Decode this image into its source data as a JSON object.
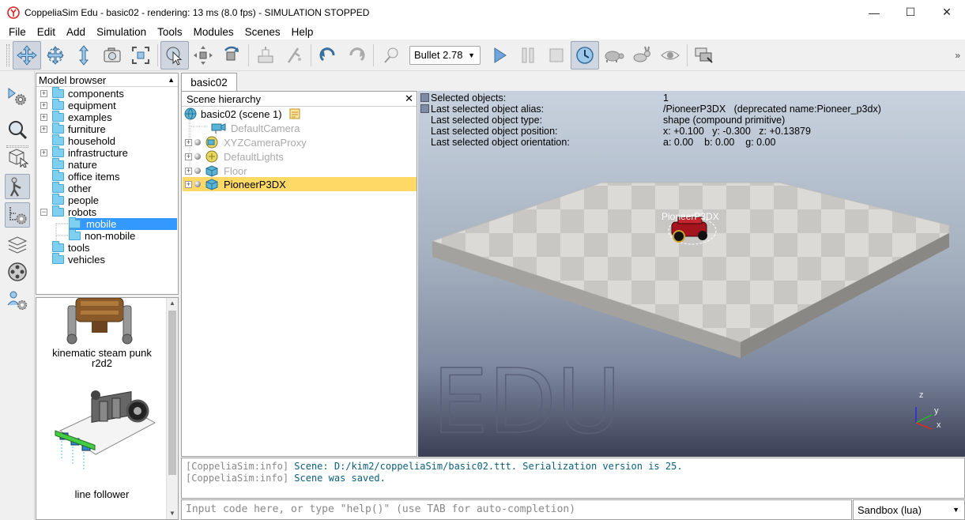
{
  "window": {
    "title": "CoppeliaSim Edu - basic02 - rendering: 13 ms (8.0 fps) - SIMULATION STOPPED",
    "minimize": "—",
    "maximize": "☐",
    "close": "✕"
  },
  "menu": [
    "File",
    "Edit",
    "Add",
    "Simulation",
    "Tools",
    "Modules",
    "Scenes",
    "Help"
  ],
  "toolbar": {
    "engine_select": "Bullet 2.78",
    "more": "»"
  },
  "model_browser": {
    "title": "Model browser",
    "items": [
      {
        "label": "components",
        "expandable": true
      },
      {
        "label": "equipment",
        "expandable": true
      },
      {
        "label": "examples",
        "expandable": true
      },
      {
        "label": "furniture",
        "expandable": true
      },
      {
        "label": "household",
        "expandable": false
      },
      {
        "label": "infrastructure",
        "expandable": true
      },
      {
        "label": "nature",
        "expandable": false
      },
      {
        "label": "office items",
        "expandable": false
      },
      {
        "label": "other",
        "expandable": false
      },
      {
        "label": "people",
        "expandable": false
      },
      {
        "label": "robots",
        "expandable": true,
        "expanded": true
      },
      {
        "label": "mobile",
        "expandable": false,
        "child": true,
        "selected": true
      },
      {
        "label": "non-mobile",
        "expandable": false,
        "child": true
      },
      {
        "label": "tools",
        "expandable": false
      },
      {
        "label": "vehicles",
        "expandable": false
      }
    ]
  },
  "thumbnails": [
    {
      "label_line1": "kinematic steam punk",
      "label_line2": "r2d2"
    },
    {
      "label_line1": "line follower",
      "label_line2": ""
    }
  ],
  "scene_tab": "basic02",
  "hierarchy": {
    "title": "Scene hierarchy",
    "close": "✕",
    "root": "basic02 (scene 1)",
    "items": [
      {
        "label": "DefaultCamera",
        "dim": true,
        "expandable": false
      },
      {
        "label": "XYZCameraProxy",
        "dim": true,
        "expandable": true
      },
      {
        "label": "DefaultLights",
        "dim": true,
        "expandable": true
      },
      {
        "label": "Floor",
        "dim": true,
        "expandable": true
      },
      {
        "label": "PioneerP3DX",
        "dim": false,
        "expandable": true,
        "selected": true
      }
    ]
  },
  "selection_info": {
    "rows": [
      {
        "key": "Selected objects:",
        "value": "1"
      },
      {
        "key": "Last selected object alias:",
        "value": "/PioneerP3DX   (deprecated name:Pioneer_p3dx)"
      },
      {
        "key": "Last selected object type:",
        "value": "shape (compound primitive)"
      },
      {
        "key": "Last selected object position:",
        "value": "x: +0.100   y: -0.300   z: +0.13879"
      },
      {
        "key": "Last selected object orientation:",
        "value": "a: 0.00    b: 0.00    g: 0.00"
      }
    ]
  },
  "viewport": {
    "robot_label": "PioneerP3DX",
    "watermark": "EDU",
    "axis_z": "z",
    "axis_y": "y",
    "axis_x": "x"
  },
  "console": {
    "lines": [
      {
        "tag": "[CoppeliaSim:info]",
        "msg": "Scene: D:/kim2/coppeliaSim/basic02.ttt. Serialization version is 25."
      },
      {
        "tag": "[CoppeliaSim:info]",
        "msg": "Scene was saved."
      }
    ],
    "input_placeholder": "Input code here, or type \"help()\" (use TAB for auto-completion)",
    "sandbox": "Sandbox (lua)"
  },
  "colors": {
    "selection_blue": "#3399ff",
    "hierarchy_selected": "#ffd966",
    "folder": "#7fcff0"
  }
}
